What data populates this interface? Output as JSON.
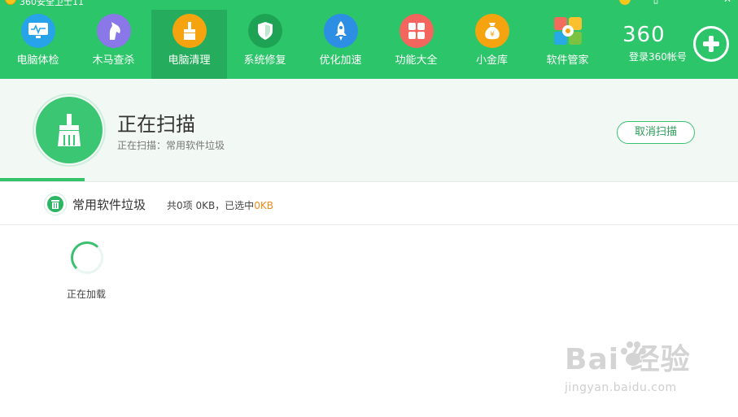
{
  "window": {
    "title": "360安全卫士11",
    "skin_icon": "skin-icon",
    "buttons": [
      "menu",
      "minimize",
      "close"
    ]
  },
  "nav": {
    "items": [
      {
        "label": "电脑体检",
        "icon": "monitor-check-icon",
        "color": "#27a3e9",
        "active": false
      },
      {
        "label": "木马查杀",
        "icon": "horse-icon",
        "color": "#8a77e8",
        "active": false
      },
      {
        "label": "电脑清理",
        "icon": "broom-icon",
        "color": "#f5a30f",
        "active": true
      },
      {
        "label": "系统修复",
        "icon": "shield-icon",
        "color": "#1da353",
        "active": false
      },
      {
        "label": "优化加速",
        "icon": "rocket-icon",
        "color": "#2d8fe4",
        "active": false
      },
      {
        "label": "功能大全",
        "icon": "grid-icon",
        "color": "#f2665d",
        "active": false
      },
      {
        "label": "小金库",
        "icon": "money-bag-icon",
        "color": "#f5a30f",
        "active": false
      },
      {
        "label": "软件管家",
        "icon": "software-manager-icon",
        "color": "#ffffff",
        "active": false
      }
    ]
  },
  "brand": {
    "logo_text": "360",
    "login_label": "登录360帐号"
  },
  "scan": {
    "title": "正在扫描",
    "subtitle": "正在扫描：常用软件垃圾",
    "cancel_label": "取消扫描"
  },
  "category": {
    "title": "常用软件垃圾",
    "stats_prefix": "共0项 0KB，已选中",
    "stats_selected": "0KB"
  },
  "loading": {
    "label": "正在加载"
  },
  "watermark": {
    "main": "Bai  经验",
    "sub": "jingyan.baidu.com"
  },
  "colors": {
    "brand_green": "#2cc56a",
    "active_tab": "#25ad5d",
    "accent_orange": "#f08a1c"
  }
}
